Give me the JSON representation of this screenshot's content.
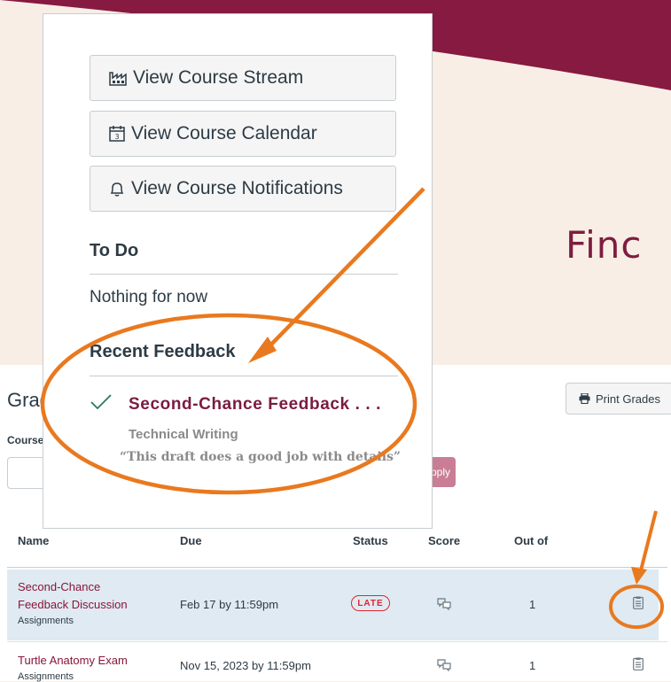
{
  "banner": {
    "text": "Finc",
    "color": "#7d1d3f",
    "background": "#f8eee6"
  },
  "card": {
    "buttons": [
      {
        "icon": "stream-icon",
        "label": "View Course Stream"
      },
      {
        "icon": "calendar-icon",
        "label": "View Course Calendar"
      },
      {
        "icon": "bell-icon",
        "label": "View Course Notifications"
      }
    ],
    "todo": {
      "heading": "To Do",
      "empty": "Nothing for now"
    },
    "feedback": {
      "heading": "Recent Feedback",
      "item": {
        "title": "Second-Chance Feedback . . .",
        "course": "Technical Writing",
        "comment": "“This draft does a good job with details”"
      }
    }
  },
  "grades": {
    "title": "Grades",
    "print_label": "Print Grades",
    "course_label": "Course",
    "apply_label": "Apply",
    "columns": [
      "Name",
      "Due",
      "Status",
      "Score",
      "Out of"
    ],
    "rows": [
      {
        "name_line1": "Second-Chance",
        "name_line2": "Feedback Discussion",
        "group": "Assignments",
        "due": "Feb 17 by 11:59pm",
        "status": "LATE",
        "out_of": "1"
      },
      {
        "name_line1": "Turtle Anatomy Exam",
        "group": "Assignments",
        "due": "Nov 15, 2023 by 11:59pm",
        "out_of": "1"
      }
    ]
  },
  "colors": {
    "brand": "#7a1b40",
    "annotation": "#e9791f",
    "late": "#e0252f"
  }
}
